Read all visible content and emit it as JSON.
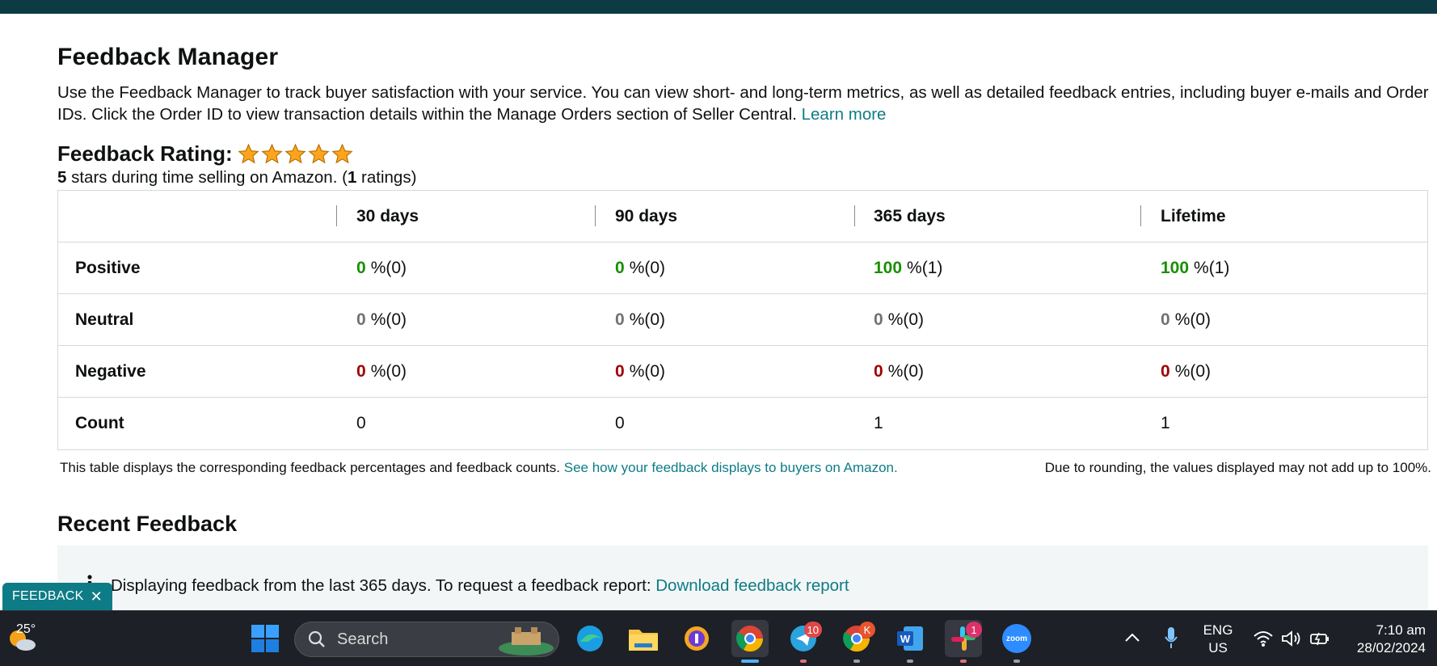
{
  "page": {
    "title": "Feedback Manager",
    "intro_text": "Use the Feedback Manager to track buyer satisfaction with your service. You can view short- and long-term metrics, as well as detailed feedback entries, including buyer e-mails and Order IDs. Click the Order ID to view transaction details within the Manage Orders section of Seller Central.",
    "learn_more": "Learn more"
  },
  "rating": {
    "label": "Feedback Rating:",
    "stars": 5,
    "stars_value": "5",
    "sub_text_mid": " stars during time selling on Amazon. (",
    "ratings_count": "1",
    "sub_text_end": " ratings)"
  },
  "table": {
    "headers": [
      "",
      "30 days",
      "90 days",
      "365 days",
      "Lifetime"
    ],
    "rows": [
      {
        "label": "Positive",
        "type": "pos",
        "cells": [
          {
            "pct": "0",
            "rest": "%(0)"
          },
          {
            "pct": "0",
            "rest": "%(0)"
          },
          {
            "pct": "100",
            "rest": "%(1)"
          },
          {
            "pct": "100",
            "rest": "%(1)"
          }
        ]
      },
      {
        "label": "Neutral",
        "type": "neu",
        "cells": [
          {
            "pct": "0",
            "rest": "%(0)"
          },
          {
            "pct": "0",
            "rest": "%(0)"
          },
          {
            "pct": "0",
            "rest": "%(0)"
          },
          {
            "pct": "0",
            "rest": "%(0)"
          }
        ]
      },
      {
        "label": "Negative",
        "type": "neg",
        "cells": [
          {
            "pct": "0",
            "rest": "%(0)"
          },
          {
            "pct": "0",
            "rest": "%(0)"
          },
          {
            "pct": "0",
            "rest": "%(0)"
          },
          {
            "pct": "0",
            "rest": "%(0)"
          }
        ]
      },
      {
        "label": "Count",
        "type": "count",
        "cells": [
          {
            "pct": "",
            "rest": "0"
          },
          {
            "pct": "",
            "rest": "0"
          },
          {
            "pct": "",
            "rest": "1"
          },
          {
            "pct": "",
            "rest": "1"
          }
        ]
      }
    ],
    "footnote": "This table displays the corresponding feedback percentages and feedback counts.",
    "footnote_link": "See how your feedback displays to buyers on Amazon.",
    "rounding_note": "Due to rounding, the values displayed may not add up to 100%."
  },
  "recent": {
    "title": "Recent Feedback",
    "info_text": "Displaying feedback from the last 365 days. To request a feedback report:",
    "download_link": "Download feedback report"
  },
  "feedback_tab": {
    "label": "FEEDBACK",
    "close": "✕"
  },
  "taskbar": {
    "weather_temp": "25°",
    "search_label": "Search",
    "telegram_badge": "10",
    "chrome_profile_badge": "K",
    "slack_badge": "1",
    "zoom_label": "zoom",
    "language_line1": "ENG",
    "language_line2": "US",
    "time": "7:10 am",
    "date": "28/02/2024"
  },
  "colors": {
    "topbar": "#0c3b44",
    "link": "#0e7c86",
    "positive": "#1a8f00",
    "neutral": "#6f7373",
    "negative": "#a00000",
    "star": "#ffa41c"
  }
}
